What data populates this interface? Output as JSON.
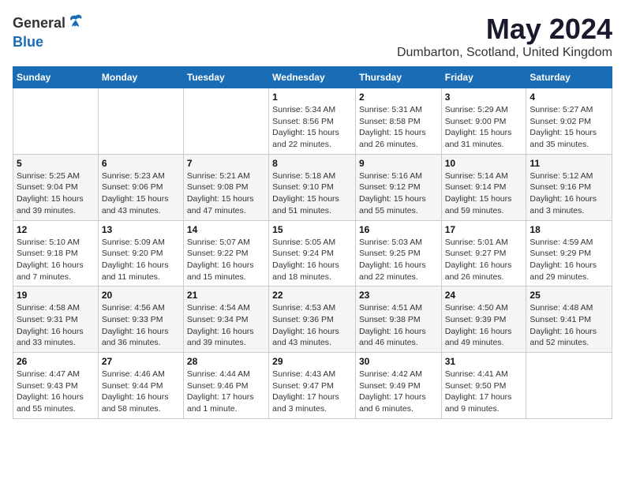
{
  "header": {
    "logo_general": "General",
    "logo_blue": "Blue",
    "month_title": "May 2024",
    "location": "Dumbarton, Scotland, United Kingdom"
  },
  "weekdays": [
    "Sunday",
    "Monday",
    "Tuesday",
    "Wednesday",
    "Thursday",
    "Friday",
    "Saturday"
  ],
  "weeks": [
    [
      {
        "day": "",
        "info": ""
      },
      {
        "day": "",
        "info": ""
      },
      {
        "day": "",
        "info": ""
      },
      {
        "day": "1",
        "info": "Sunrise: 5:34 AM\nSunset: 8:56 PM\nDaylight: 15 hours\nand 22 minutes."
      },
      {
        "day": "2",
        "info": "Sunrise: 5:31 AM\nSunset: 8:58 PM\nDaylight: 15 hours\nand 26 minutes."
      },
      {
        "day": "3",
        "info": "Sunrise: 5:29 AM\nSunset: 9:00 PM\nDaylight: 15 hours\nand 31 minutes."
      },
      {
        "day": "4",
        "info": "Sunrise: 5:27 AM\nSunset: 9:02 PM\nDaylight: 15 hours\nand 35 minutes."
      }
    ],
    [
      {
        "day": "5",
        "info": "Sunrise: 5:25 AM\nSunset: 9:04 PM\nDaylight: 15 hours\nand 39 minutes."
      },
      {
        "day": "6",
        "info": "Sunrise: 5:23 AM\nSunset: 9:06 PM\nDaylight: 15 hours\nand 43 minutes."
      },
      {
        "day": "7",
        "info": "Sunrise: 5:21 AM\nSunset: 9:08 PM\nDaylight: 15 hours\nand 47 minutes."
      },
      {
        "day": "8",
        "info": "Sunrise: 5:18 AM\nSunset: 9:10 PM\nDaylight: 15 hours\nand 51 minutes."
      },
      {
        "day": "9",
        "info": "Sunrise: 5:16 AM\nSunset: 9:12 PM\nDaylight: 15 hours\nand 55 minutes."
      },
      {
        "day": "10",
        "info": "Sunrise: 5:14 AM\nSunset: 9:14 PM\nDaylight: 15 hours\nand 59 minutes."
      },
      {
        "day": "11",
        "info": "Sunrise: 5:12 AM\nSunset: 9:16 PM\nDaylight: 16 hours\nand 3 minutes."
      }
    ],
    [
      {
        "day": "12",
        "info": "Sunrise: 5:10 AM\nSunset: 9:18 PM\nDaylight: 16 hours\nand 7 minutes."
      },
      {
        "day": "13",
        "info": "Sunrise: 5:09 AM\nSunset: 9:20 PM\nDaylight: 16 hours\nand 11 minutes."
      },
      {
        "day": "14",
        "info": "Sunrise: 5:07 AM\nSunset: 9:22 PM\nDaylight: 16 hours\nand 15 minutes."
      },
      {
        "day": "15",
        "info": "Sunrise: 5:05 AM\nSunset: 9:24 PM\nDaylight: 16 hours\nand 18 minutes."
      },
      {
        "day": "16",
        "info": "Sunrise: 5:03 AM\nSunset: 9:25 PM\nDaylight: 16 hours\nand 22 minutes."
      },
      {
        "day": "17",
        "info": "Sunrise: 5:01 AM\nSunset: 9:27 PM\nDaylight: 16 hours\nand 26 minutes."
      },
      {
        "day": "18",
        "info": "Sunrise: 4:59 AM\nSunset: 9:29 PM\nDaylight: 16 hours\nand 29 minutes."
      }
    ],
    [
      {
        "day": "19",
        "info": "Sunrise: 4:58 AM\nSunset: 9:31 PM\nDaylight: 16 hours\nand 33 minutes."
      },
      {
        "day": "20",
        "info": "Sunrise: 4:56 AM\nSunset: 9:33 PM\nDaylight: 16 hours\nand 36 minutes."
      },
      {
        "day": "21",
        "info": "Sunrise: 4:54 AM\nSunset: 9:34 PM\nDaylight: 16 hours\nand 39 minutes."
      },
      {
        "day": "22",
        "info": "Sunrise: 4:53 AM\nSunset: 9:36 PM\nDaylight: 16 hours\nand 43 minutes."
      },
      {
        "day": "23",
        "info": "Sunrise: 4:51 AM\nSunset: 9:38 PM\nDaylight: 16 hours\nand 46 minutes."
      },
      {
        "day": "24",
        "info": "Sunrise: 4:50 AM\nSunset: 9:39 PM\nDaylight: 16 hours\nand 49 minutes."
      },
      {
        "day": "25",
        "info": "Sunrise: 4:48 AM\nSunset: 9:41 PM\nDaylight: 16 hours\nand 52 minutes."
      }
    ],
    [
      {
        "day": "26",
        "info": "Sunrise: 4:47 AM\nSunset: 9:43 PM\nDaylight: 16 hours\nand 55 minutes."
      },
      {
        "day": "27",
        "info": "Sunrise: 4:46 AM\nSunset: 9:44 PM\nDaylight: 16 hours\nand 58 minutes."
      },
      {
        "day": "28",
        "info": "Sunrise: 4:44 AM\nSunset: 9:46 PM\nDaylight: 17 hours\nand 1 minute."
      },
      {
        "day": "29",
        "info": "Sunrise: 4:43 AM\nSunset: 9:47 PM\nDaylight: 17 hours\nand 3 minutes."
      },
      {
        "day": "30",
        "info": "Sunrise: 4:42 AM\nSunset: 9:49 PM\nDaylight: 17 hours\nand 6 minutes."
      },
      {
        "day": "31",
        "info": "Sunrise: 4:41 AM\nSunset: 9:50 PM\nDaylight: 17 hours\nand 9 minutes."
      },
      {
        "day": "",
        "info": ""
      }
    ]
  ]
}
